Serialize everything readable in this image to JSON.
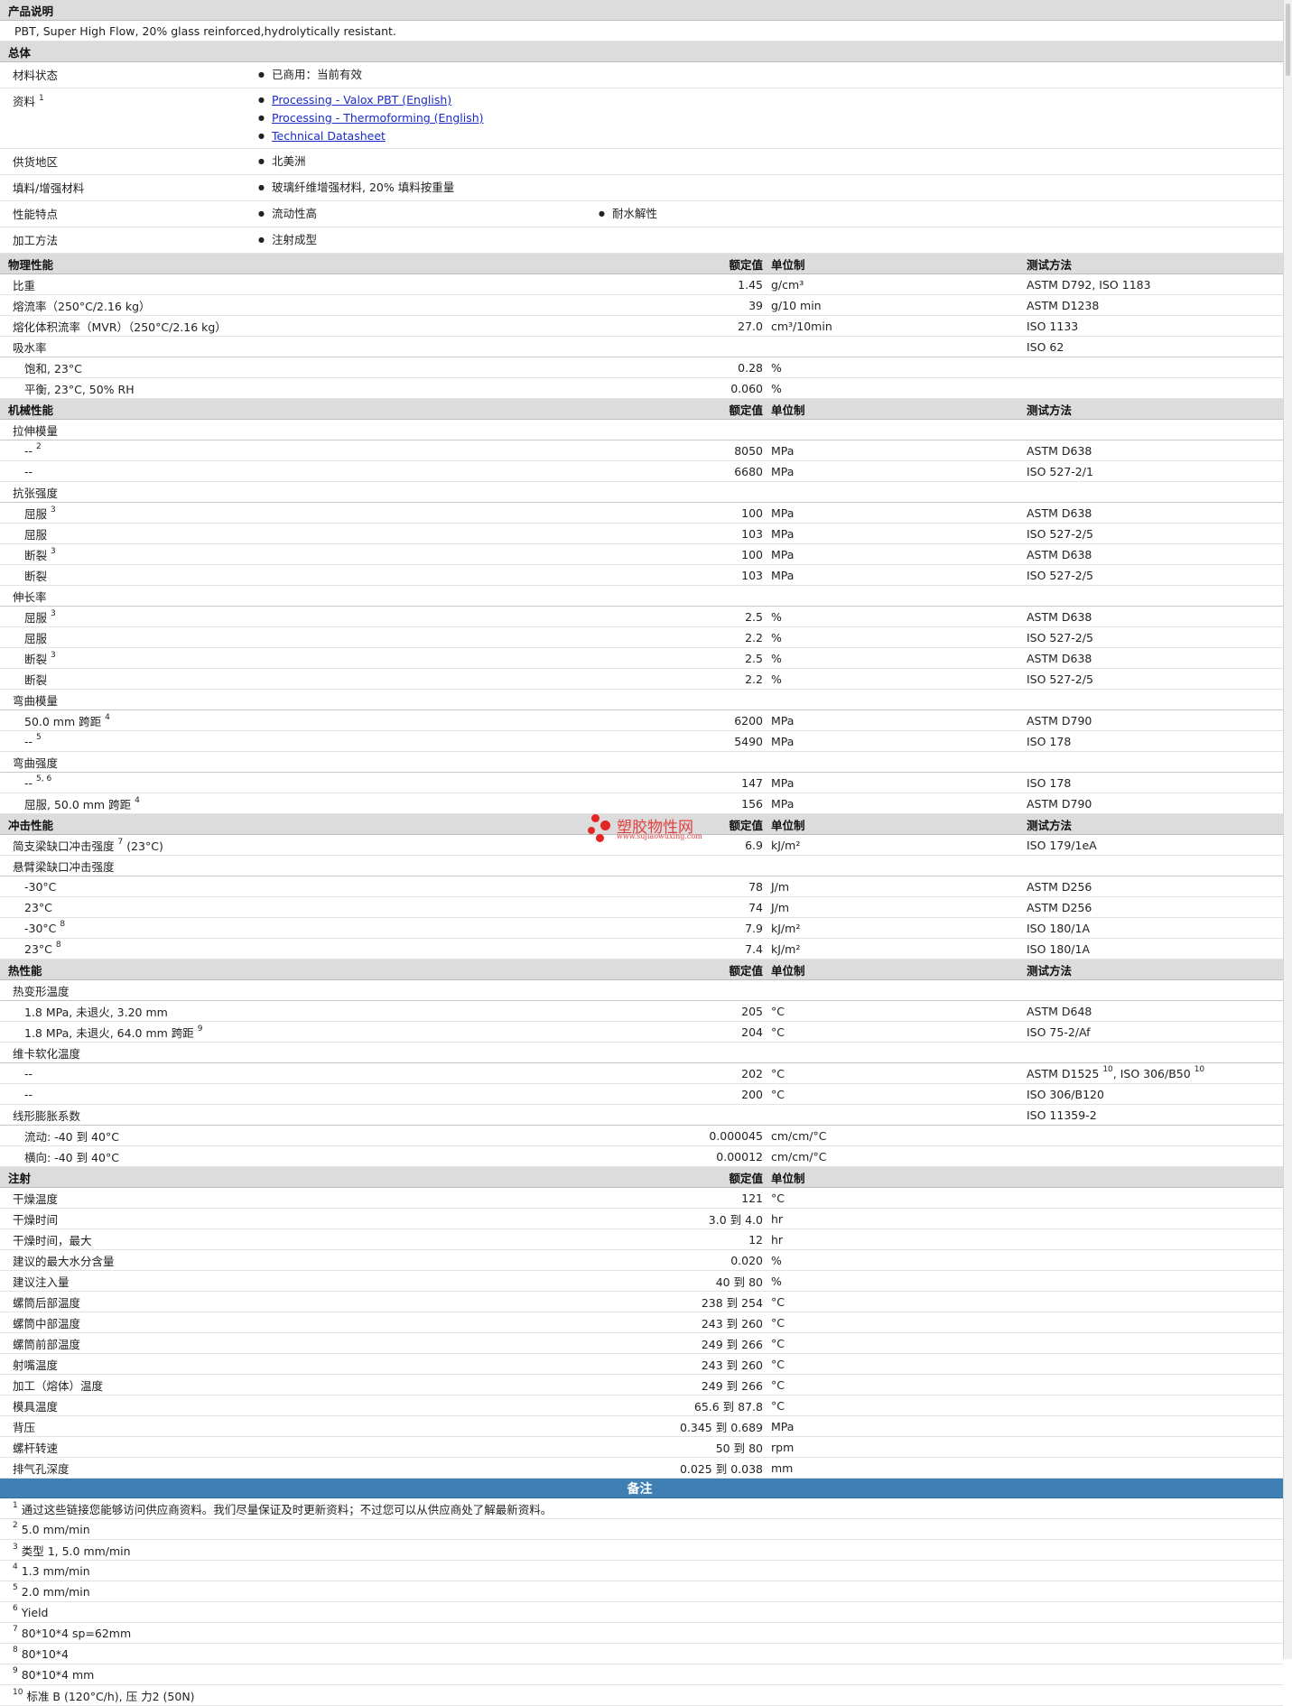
{
  "description": {
    "heading": "产品说明",
    "text": "PBT, Super High Flow, 20% glass reinforced,hydrolytically resistant."
  },
  "general": {
    "heading": "总体",
    "status_label": "材料状态",
    "status_value": "已商用：当前有效",
    "docs_label": "资料",
    "docs_sup": "1",
    "docs_links": [
      "Processing - Valox PBT (English)",
      "Processing - Thermoforming (English)",
      "Technical Datasheet"
    ],
    "region_label": "供货地区",
    "region_value": "北美洲",
    "filler_label": "填料/增强材料",
    "filler_value": "玻璃纤维增强材料, 20% 填料按重量",
    "features_label": "性能特点",
    "features_value_1": "流动性高",
    "features_value_2": "耐水解性",
    "method_label": "加工方法",
    "method_value": "注射成型"
  },
  "col": {
    "rated": "额定值",
    "unit": "单位制",
    "test": "测试方法"
  },
  "sections": {
    "physical": {
      "heading": "物理性能",
      "rows": [
        {
          "label": "比重",
          "sup": "",
          "value": "1.45",
          "unit": "g/cm³",
          "test": "ASTM D792, ISO 1183"
        },
        {
          "label": "熔流率（250°C/2.16 kg）",
          "sup": "",
          "value": "39",
          "unit": "g/10 min",
          "test": "ASTM D1238"
        },
        {
          "label": "熔化体积流率（MVR）（250°C/2.16 kg）",
          "sup": "",
          "value": "27.0",
          "unit": "cm³/10min",
          "test": "ISO 1133"
        },
        {
          "label": "吸水率",
          "sup": "",
          "value": "",
          "unit": "",
          "test": "ISO 62",
          "group": true
        },
        {
          "label": "饱和, 23°C",
          "sup": "",
          "value": "0.28",
          "unit": "%",
          "test": "",
          "sub": true
        },
        {
          "label": "平衡, 23°C, 50% RH",
          "sup": "",
          "value": "0.060",
          "unit": "%",
          "test": "",
          "sub": true
        }
      ]
    },
    "mechanical": {
      "heading": "机械性能",
      "rows": [
        {
          "label": "拉伸模量",
          "group": true
        },
        {
          "label": "--",
          "sup": "2",
          "value": "8050",
          "unit": "MPa",
          "test": "ASTM D638",
          "sub": true
        },
        {
          "label": "--",
          "sup": "",
          "value": "6680",
          "unit": "MPa",
          "test": "ISO 527-2/1",
          "sub": true
        },
        {
          "label": "抗张强度",
          "group": true
        },
        {
          "label": "屈服",
          "sup": "3",
          "value": "100",
          "unit": "MPa",
          "test": "ASTM D638",
          "sub": true
        },
        {
          "label": "屈服",
          "sup": "",
          "value": "103",
          "unit": "MPa",
          "test": "ISO 527-2/5",
          "sub": true
        },
        {
          "label": "断裂",
          "sup": "3",
          "value": "100",
          "unit": "MPa",
          "test": "ASTM D638",
          "sub": true
        },
        {
          "label": "断裂",
          "sup": "",
          "value": "103",
          "unit": "MPa",
          "test": "ISO 527-2/5",
          "sub": true
        },
        {
          "label": "伸长率",
          "group": true
        },
        {
          "label": "屈服",
          "sup": "3",
          "value": "2.5",
          "unit": "%",
          "test": "ASTM D638",
          "sub": true
        },
        {
          "label": "屈服",
          "sup": "",
          "value": "2.2",
          "unit": "%",
          "test": "ISO 527-2/5",
          "sub": true
        },
        {
          "label": "断裂",
          "sup": "3",
          "value": "2.5",
          "unit": "%",
          "test": "ASTM D638",
          "sub": true
        },
        {
          "label": "断裂",
          "sup": "",
          "value": "2.2",
          "unit": "%",
          "test": "ISO 527-2/5",
          "sub": true
        },
        {
          "label": "弯曲模量",
          "group": true
        },
        {
          "label": "50.0 mm 跨距",
          "sup": "4",
          "value": "6200",
          "unit": "MPa",
          "test": "ASTM D790",
          "sub": true
        },
        {
          "label": "--",
          "sup": "5",
          "value": "5490",
          "unit": "MPa",
          "test": "ISO 178",
          "sub": true
        },
        {
          "label": "弯曲强度",
          "group": true
        },
        {
          "label": "--",
          "sup": "5, 6",
          "value": "147",
          "unit": "MPa",
          "test": "ISO 178",
          "sub": true
        },
        {
          "label": "屈服, 50.0 mm 跨距",
          "sup": "4",
          "value": "156",
          "unit": "MPa",
          "test": "ASTM D790",
          "sub": true
        }
      ]
    },
    "impact": {
      "heading": "冲击性能",
      "rows": [
        {
          "label": "简支梁缺口冲击强度",
          "sup": "7",
          "suffix": " (23°C)",
          "value": "6.9",
          "unit": "kJ/m²",
          "test": "ISO 179/1eA"
        },
        {
          "label": "悬臂梁缺口冲击强度",
          "group": true
        },
        {
          "label": "-30°C",
          "sup": "",
          "value": "78",
          "unit": "J/m",
          "test": "ASTM D256",
          "sub": true
        },
        {
          "label": "23°C",
          "sup": "",
          "value": "74",
          "unit": "J/m",
          "test": "ASTM D256",
          "sub": true
        },
        {
          "label": "-30°C",
          "sup": "8",
          "value": "7.9",
          "unit": "kJ/m²",
          "test": "ISO 180/1A",
          "sub": true
        },
        {
          "label": "23°C",
          "sup": "8",
          "value": "7.4",
          "unit": "kJ/m²",
          "test": "ISO 180/1A",
          "sub": true
        }
      ]
    },
    "thermal": {
      "heading": "热性能",
      "rows": [
        {
          "label": "热变形温度",
          "group": true
        },
        {
          "label": "1.8 MPa, 未退火, 3.20 mm",
          "sup": "",
          "value": "205",
          "unit": "°C",
          "test": "ASTM D648",
          "sub": true
        },
        {
          "label": "1.8 MPa, 未退火, 64.0 mm 跨距",
          "sup": "9",
          "value": "204",
          "unit": "°C",
          "test": "ISO 75-2/Af",
          "sub": true
        },
        {
          "label": "维卡软化温度",
          "group": true
        },
        {
          "label": "--",
          "sup": "",
          "value": "202",
          "unit": "°C",
          "test": "ASTM D1525",
          "test_sup": "10",
          "test2": ", ISO 306/B50",
          "test2_sup": "10",
          "sub": true
        },
        {
          "label": "--",
          "sup": "",
          "value": "200",
          "unit": "°C",
          "test": "ISO 306/B120",
          "sub": true
        },
        {
          "label": "线形膨胀系数",
          "group": true,
          "test": "ISO 11359-2"
        },
        {
          "label": "流动: -40 到  40°C",
          "sup": "",
          "value": "0.000045",
          "unit": "cm/cm/°C",
          "test": "",
          "sub": true
        },
        {
          "label": "横向: -40 到  40°C",
          "sup": "",
          "value": "0.00012",
          "unit": "cm/cm/°C",
          "test": "",
          "sub": true
        }
      ]
    },
    "injection": {
      "heading": "注射",
      "rows": [
        {
          "label": "干燥温度",
          "value": "121",
          "unit": "°C"
        },
        {
          "label": "干燥时间",
          "value": "3.0 到  4.0",
          "unit": "hr"
        },
        {
          "label": "干燥时间，最大",
          "value": "12",
          "unit": "hr"
        },
        {
          "label": "建议的最大水分含量",
          "value": "0.020",
          "unit": "%"
        },
        {
          "label": "建议注入量",
          "value": "40 到  80",
          "unit": "%"
        },
        {
          "label": "螺筒后部温度",
          "value": "238 到  254",
          "unit": "°C"
        },
        {
          "label": "螺筒中部温度",
          "value": "243 到  260",
          "unit": "°C"
        },
        {
          "label": "螺筒前部温度",
          "value": "249 到  266",
          "unit": "°C"
        },
        {
          "label": "射嘴温度",
          "value": "243 到  260",
          "unit": "°C"
        },
        {
          "label": "加工（熔体）温度",
          "value": "249 到  266",
          "unit": "°C"
        },
        {
          "label": "模具温度",
          "value": "65.6 到  87.8",
          "unit": "°C"
        },
        {
          "label": "背压",
          "value": "0.345 到  0.689",
          "unit": "MPa"
        },
        {
          "label": "螺杆转速",
          "value": "50 到  80",
          "unit": "rpm"
        },
        {
          "label": "排气孔深度",
          "value": "0.025 到  0.038",
          "unit": "mm"
        }
      ]
    }
  },
  "notes": {
    "heading": "备注",
    "items": [
      {
        "num": "1",
        "text": "通过这些链接您能够访问供应商资料。我们尽量保证及时更新资料；不过您可以从供应商处了解最新资料。"
      },
      {
        "num": "2",
        "text": "5.0 mm/min"
      },
      {
        "num": "3",
        "text": "类型  1, 5.0 mm/min"
      },
      {
        "num": "4",
        "text": "1.3 mm/min"
      },
      {
        "num": "5",
        "text": "2.0 mm/min"
      },
      {
        "num": "6",
        "text": "Yield"
      },
      {
        "num": "7",
        "text": "80*10*4 sp=62mm"
      },
      {
        "num": "8",
        "text": "80*10*4"
      },
      {
        "num": "9",
        "text": "80*10*4 mm"
      },
      {
        "num": "10",
        "text": "标准  B (120°C/h), 压  力2 (50N)"
      }
    ]
  },
  "watermark": {
    "title": "塑胶物性网",
    "url": "www.sujiaowuxing.com"
  },
  "colors": {
    "section_bg": "#dcdcdc",
    "notes_bg": "#3f7fb4",
    "link": "#1a2bc8",
    "watermark": "#e22525"
  }
}
